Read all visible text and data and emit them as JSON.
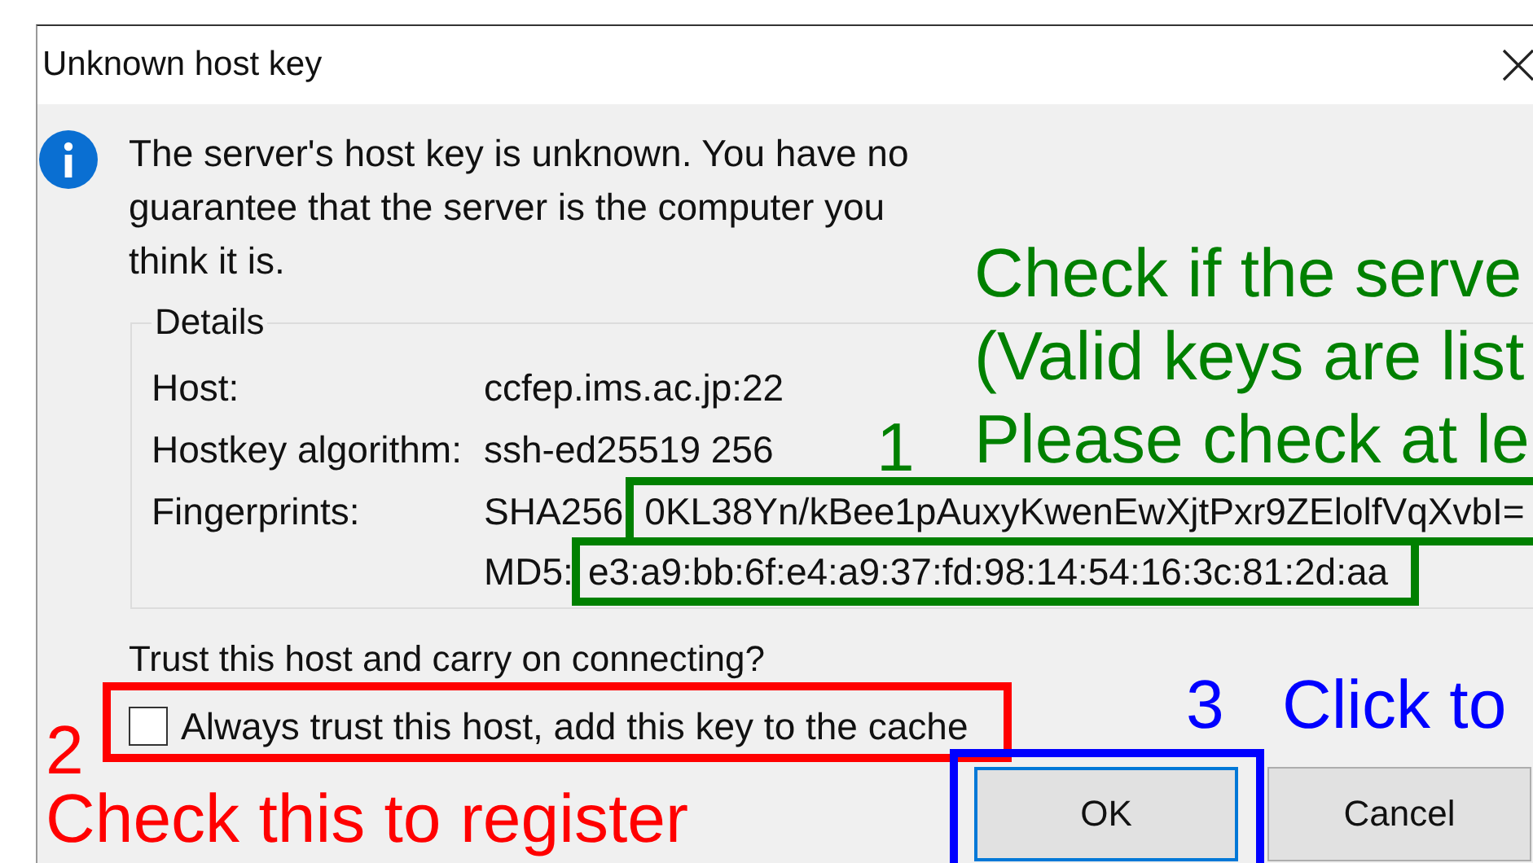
{
  "window": {
    "title": "Unknown host key"
  },
  "message": "The server's host key is unknown. You have no guarantee that the server is the computer you think it is.",
  "details": {
    "legend": "Details",
    "rows": [
      {
        "label": "Host:",
        "value": "ccfep.ims.ac.jp:22"
      },
      {
        "label": "Hostkey algorithm:",
        "value": "ssh-ed25519 256"
      }
    ],
    "fingerprints": {
      "label": "Fingerprints:",
      "entries": [
        {
          "type": "SHA256",
          "value": "0KL38Yn/kBee1pAuxyKwenEwXjtPxr9ZElolfVqXvbI="
        },
        {
          "type": "MD5:",
          "value": "e3:a9:bb:6f:e4:a9:37:fd:98:14:54:16:3c:81:2d:aa"
        }
      ]
    }
  },
  "question": "Trust this host and carry on connecting?",
  "checkbox": {
    "label": "Always trust this host, add this key to the cache",
    "checked": false
  },
  "buttons": [
    {
      "label": "OK"
    },
    {
      "label": "Cancel"
    }
  ],
  "annotations": [
    {
      "number": "1",
      "color": "#008000",
      "lines": [
        "Check if the serve",
        "(Valid keys are list",
        "Please check at le"
      ]
    },
    {
      "number": "2",
      "color": "#ff0000",
      "lines": [
        "Check this to register"
      ]
    },
    {
      "number": "3",
      "color": "#0000ff",
      "lines": [
        "Click to"
      ]
    }
  ]
}
